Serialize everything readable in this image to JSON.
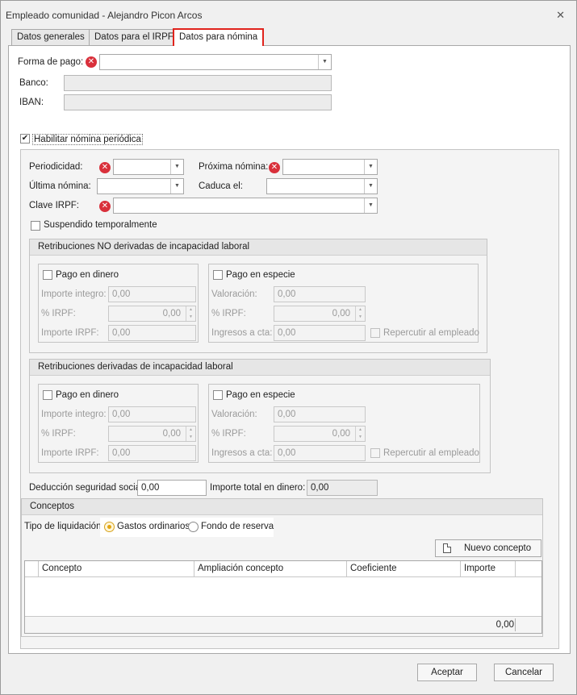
{
  "window": {
    "title": "Empleado comunidad - Alejandro Picon Arcos",
    "close_glyph": "✕"
  },
  "tabs": [
    "Datos generales",
    "Datos para el IRPF",
    "Datos para nómina"
  ],
  "pago": {
    "forma_label": "Forma de pago:",
    "forma_value": "",
    "banco_label": "Banco:",
    "banco_value": "",
    "iban_label": "IBAN:",
    "iban_value": ""
  },
  "habilitar_label": "Habilitar nómina periódica",
  "periodica": {
    "periodicidad_label": "Periodicidad:",
    "proxima_label": "Próxima nómina:",
    "ultima_label": "Última nómina:",
    "caduca_label": "Caduca el:",
    "clave_label": "Clave IRPF:",
    "suspendido_label": "Suspendido temporalmente"
  },
  "grupo_no": {
    "title": "Retribuciones NO derivadas de incapacidad laboral",
    "dinero": {
      "title": "Pago en dinero",
      "importe_label": "Importe integro:",
      "importe_value": "0,00",
      "irpf_label": "% IRPF:",
      "irpf_value": "0,00",
      "importe_irpf_label": "Importe IRPF:",
      "importe_irpf_value": "0,00"
    },
    "especie": {
      "title": "Pago en especie",
      "valoracion_label": "Valoración:",
      "valoracion_value": "0,00",
      "irpf_label": "% IRPF:",
      "irpf_value": "0,00",
      "ingresos_label": "Ingresos a cta:",
      "ingresos_value": "0,00",
      "repercutir_label": "Repercutir al empleado"
    }
  },
  "grupo_si": {
    "title": "Retribuciones derivadas de incapacidad laboral",
    "dinero": {
      "title": "Pago en dinero",
      "importe_label": "Importe integro:",
      "importe_value": "0,00",
      "irpf_label": "% IRPF:",
      "irpf_value": "0,00",
      "importe_irpf_label": "Importe IRPF:",
      "importe_irpf_value": "0,00"
    },
    "especie": {
      "title": "Pago en especie",
      "valoracion_label": "Valoración:",
      "valoracion_value": "0,00",
      "irpf_label": "% IRPF:",
      "irpf_value": "0,00",
      "ingresos_label": "Ingresos a cta:",
      "ingresos_value": "0,00",
      "repercutir_label": "Repercutir al empleado"
    }
  },
  "deduccion_label": "Deducción seguridad social:",
  "deduccion_value": "0,00",
  "importe_total_label": "Importe total en dinero:",
  "importe_total_value": "0,00",
  "conceptos": {
    "title": "Conceptos",
    "tipo_label": "Tipo de liquidación:",
    "gastos_label": "Gastos ordinarios",
    "fondo_label": "Fondo de reserva",
    "nuevo_label": "Nuevo concepto",
    "columns": [
      "Concepto",
      "Ampliación concepto",
      "Coeficiente",
      "Importe"
    ],
    "total": "0,00"
  },
  "buttons": {
    "aceptar": "Aceptar",
    "cancelar": "Cancelar"
  }
}
